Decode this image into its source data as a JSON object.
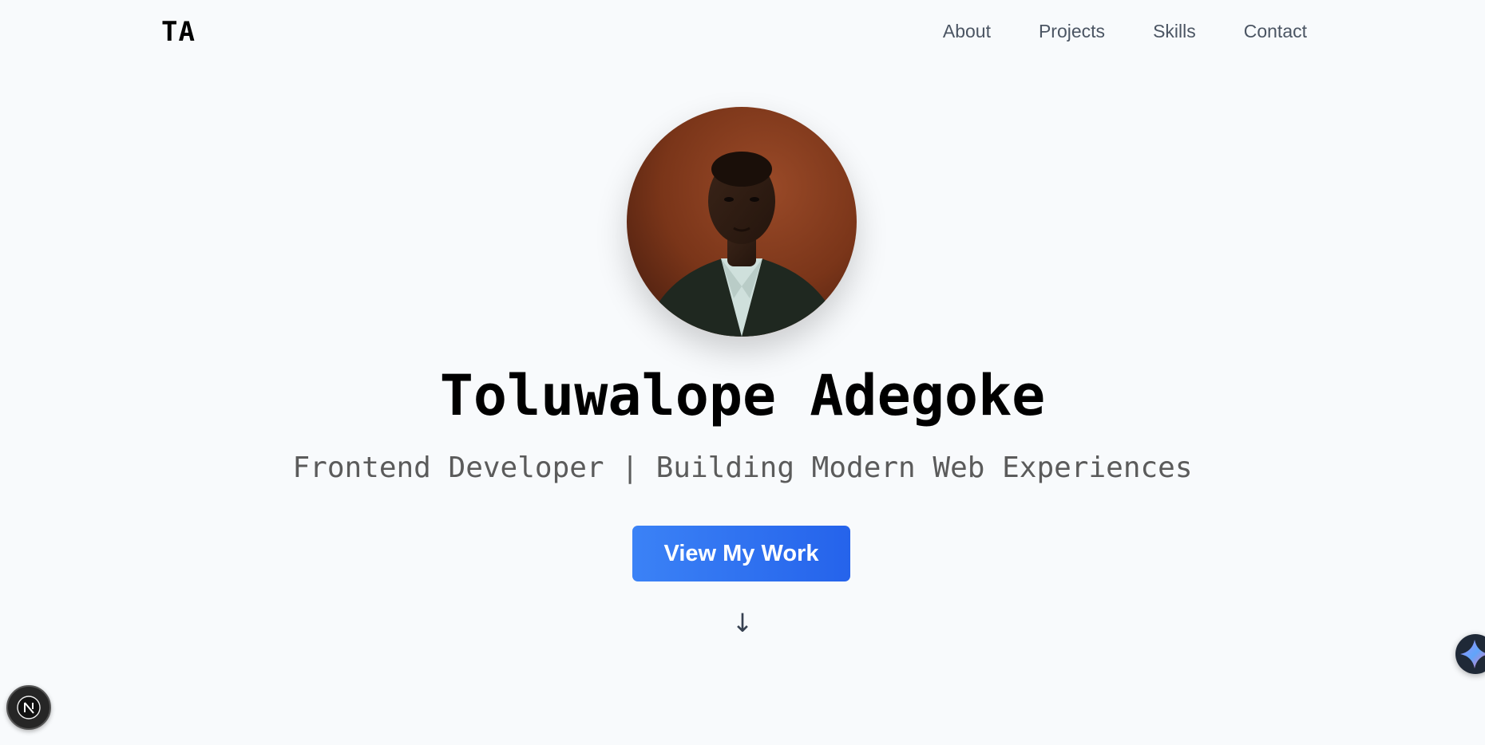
{
  "nav": {
    "logo": "TA",
    "links": [
      {
        "label": "About"
      },
      {
        "label": "Projects"
      },
      {
        "label": "Skills"
      },
      {
        "label": "Contact"
      }
    ]
  },
  "hero": {
    "name": "Toluwalope Adegoke",
    "tagline": "Frontend Developer | Building Modern Web Experiences",
    "cta_label": "View My Work",
    "scroll_arrow": "↓",
    "avatar_alt": "Toluwalope Adegoke"
  },
  "badges": {
    "next_letter": "N"
  },
  "colors": {
    "background": "#f8fafc",
    "accent": "#3b82f6",
    "text": "#000000",
    "muted": "#5b5b5b"
  },
  "icons": {
    "scroll": "arrow-down-icon",
    "dev_indicator": "nextjs-logo-icon",
    "assistant": "sparkle-icon"
  }
}
